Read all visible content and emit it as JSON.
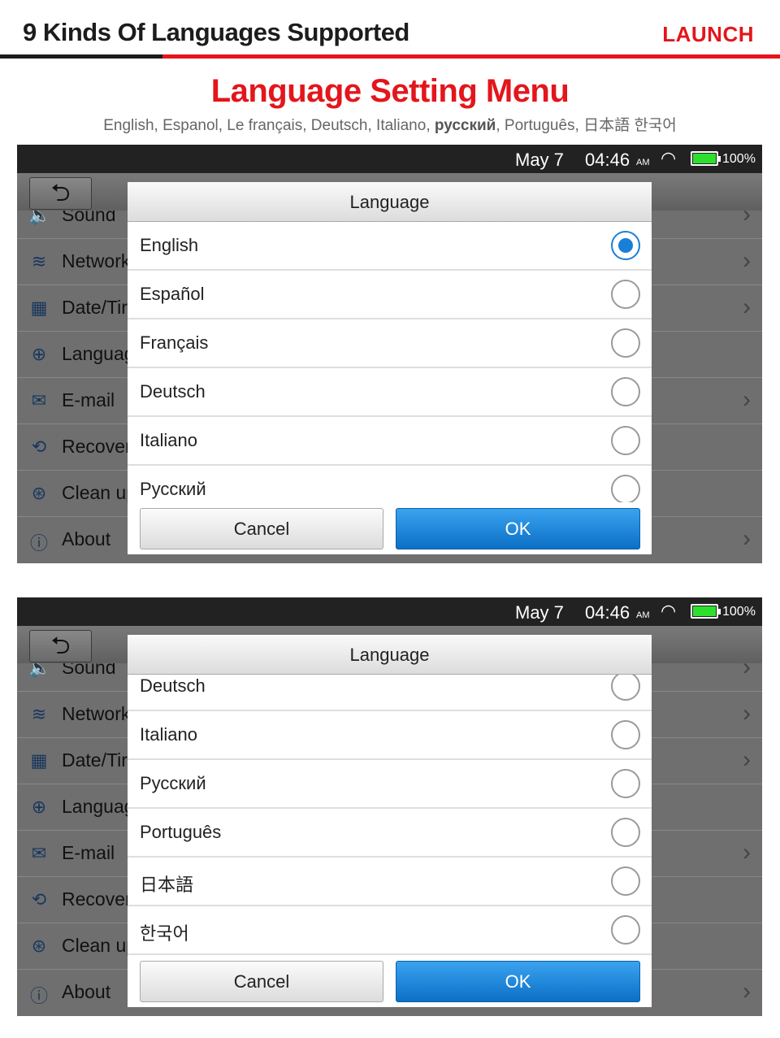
{
  "header": {
    "title": "9 Kinds Of Languages Supported",
    "brand": "LAUNCH"
  },
  "heading": "Language Setting Menu",
  "subtitle": {
    "before": "English, Espanol, Le français, Deutsch, Italiano, ",
    "bold": "русский",
    "after": ", Português, 日本語  한국어"
  },
  "colors": {
    "accent": "#e3161c",
    "selected": "#1a7fd8",
    "ok_button": "#1a86dc"
  },
  "status": {
    "date": "May 7",
    "time": "04:46",
    "ampm": "AM",
    "battery": "100%",
    "battery_level": 100
  },
  "settings": [
    {
      "label": "Sound",
      "icon": "speaker-icon",
      "chevron": true
    },
    {
      "label": "Network",
      "icon": "wifi-icon",
      "chevron": true
    },
    {
      "label": "Date/Tir",
      "icon": "calendar-icon",
      "chevron": true
    },
    {
      "label": "Languag",
      "icon": "globe-icon",
      "chevron": false
    },
    {
      "label": "E-mail",
      "icon": "email-icon",
      "chevron": true
    },
    {
      "label": "Recover",
      "icon": "recovery-icon",
      "chevron": false
    },
    {
      "label": "Clean up",
      "icon": "clean-icon",
      "chevron": false
    },
    {
      "label": "About",
      "icon": "info-icon",
      "chevron": true
    }
  ],
  "dialog": {
    "title": "Language",
    "cancel": "Cancel",
    "ok": "OK",
    "languages": [
      "English",
      "Español",
      "Français",
      "Deutsch",
      "Italiano",
      "Русский",
      "Português",
      "日本語",
      "한국어"
    ],
    "selected": "English"
  },
  "panels": [
    {
      "scroll_start_item": "English"
    },
    {
      "scroll_start_item": "Deutsch"
    }
  ]
}
